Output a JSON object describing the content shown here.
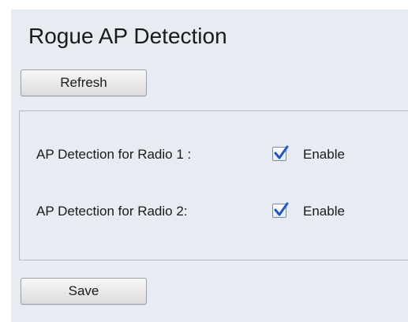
{
  "page": {
    "title": "Rogue AP Detection"
  },
  "toolbar": {
    "refresh_label": "Refresh",
    "save_label": "Save"
  },
  "settings": [
    {
      "label": "AP Detection for Radio 1 :",
      "checked": true,
      "option_label": "Enable"
    },
    {
      "label": "AP Detection for Radio 2:",
      "checked": true,
      "option_label": "Enable"
    }
  ],
  "colors": {
    "panel_background": "#e7ebf2",
    "checkmark": "#1f57c3"
  },
  "icons": {
    "checkbox_checked": "checkmark-icon"
  }
}
